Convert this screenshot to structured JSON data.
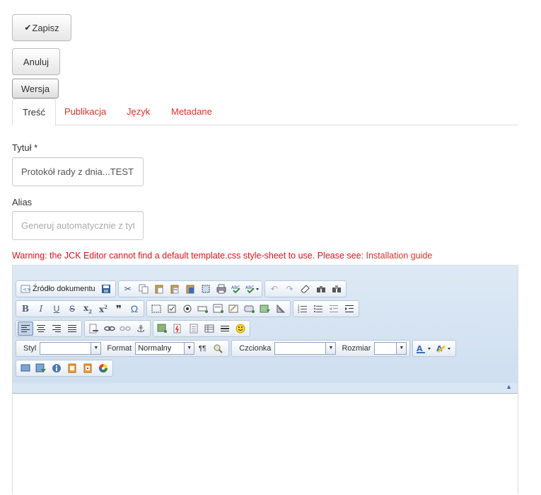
{
  "actions": {
    "save_label": "Zapisz",
    "cancel_label": "Anuluj",
    "version_label": "Wersja"
  },
  "tabs": [
    {
      "label": "Treść",
      "active": true
    },
    {
      "label": "Publikacja",
      "active": false
    },
    {
      "label": "Język",
      "active": false
    },
    {
      "label": "Metadane",
      "active": false
    }
  ],
  "form": {
    "title_label": "Tytuł *",
    "title_value": "Protokół rady z dnia...TEST",
    "alias_label": "Alias",
    "alias_placeholder": "Generuj automatycznie z tytułu"
  },
  "warning": {
    "text": "Warning: the JCK Editor cannot find a default template.css style-sheet to use. Please see: ",
    "link_label": "Installation guide"
  },
  "editor": {
    "source_label": "Źródło dokumentu",
    "style_label": "Styl",
    "style_value": "",
    "format_label": "Format",
    "format_value": "Normalny",
    "font_label": "Czcionka",
    "font_value": "",
    "size_label": "Rozmiar",
    "size_value": ""
  },
  "colors": {
    "accent": "#e0312a",
    "warning": "#e0121a",
    "toolbar_bg": "#d9e6f3"
  }
}
